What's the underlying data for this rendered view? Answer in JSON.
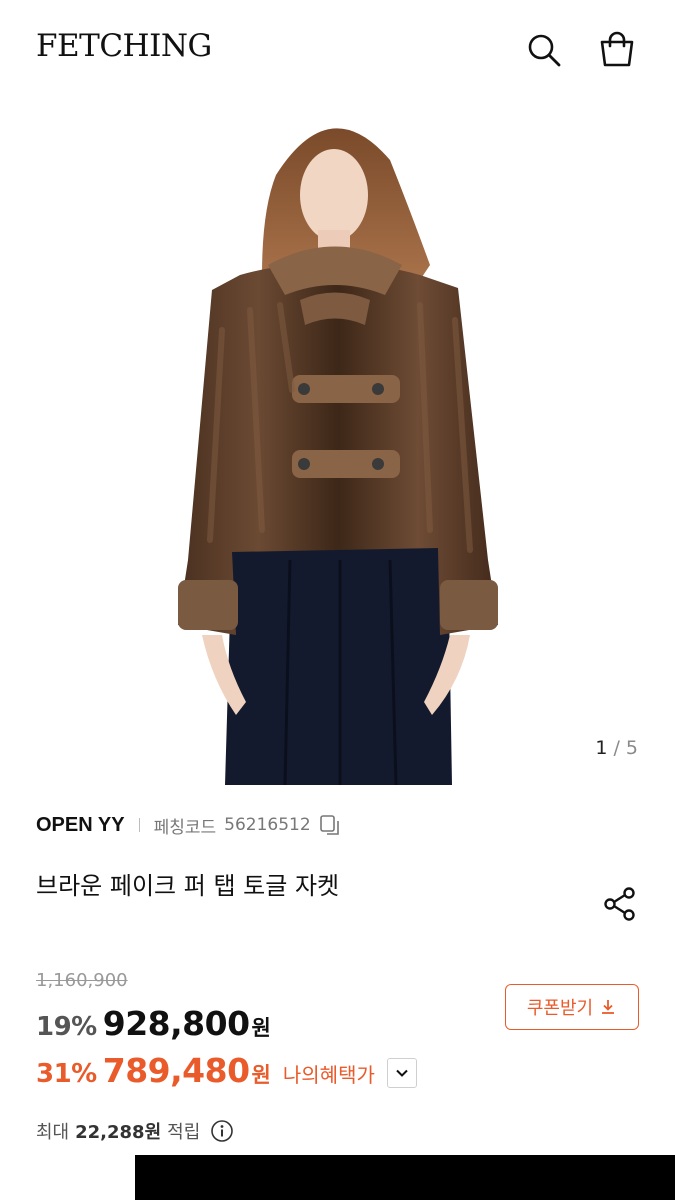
{
  "header": {
    "logo": "FETCHING",
    "search_icon": "search-icon",
    "bag_icon": "shopping-bag-icon"
  },
  "gallery": {
    "current": "1",
    "separator": " / ",
    "total": "5"
  },
  "product": {
    "brand": "OPEN YY",
    "code_label": "페칭코드",
    "code": "56216512",
    "title": "브라운 페이크 퍼 탭 토글 자켓"
  },
  "pricing": {
    "original": "1,160,900",
    "discount_pct": "19%",
    "price": "928,800",
    "currency": "원",
    "my_pct": "31%",
    "my_price": "789,480",
    "my_benefit_label": "나의혜택가",
    "coupon_label": "쿠폰받기"
  },
  "points": {
    "prefix": "최대",
    "value": "22,288원",
    "suffix": "적립"
  },
  "colors": {
    "accent": "#ea5b2b",
    "text": "#111111",
    "muted": "#777777"
  }
}
